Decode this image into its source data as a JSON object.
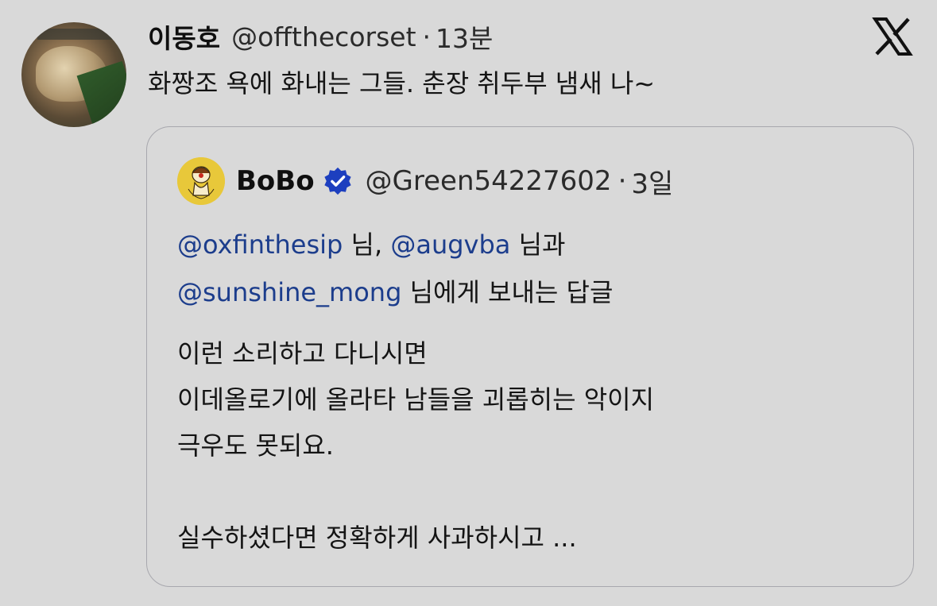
{
  "post": {
    "author_name": "이동호",
    "author_handle": "@offthecorset",
    "separator": "·",
    "time": "13분",
    "text": "화짱조 욕에 화내는 그들. 춘장 취두부 냄새 나~",
    "brand_icon": "x-logo-icon"
  },
  "quote": {
    "author_name": "BoBo",
    "verified_icon": "verified-badge-icon",
    "verified_color": "#1d3fbf",
    "author_handle": "@Green54227602",
    "separator": "·",
    "time": "3일",
    "reply_to": {
      "mention_1": "@oxfinthesip",
      "word_1": " 님, ",
      "mention_2": "@augvba",
      "word_2": " 님과",
      "mention_3": "@sunshine_mong",
      "word_3": " 님에게 보내는 답글"
    },
    "body_lines": [
      "이런 소리하고 다니시면",
      "이데올로기에 올라타 남들을 괴롭히는 악이지",
      "극우도 못되요.",
      "실수하셨다면 정확하게 사과하시고 ..."
    ]
  },
  "colors": {
    "background": "#d9d9d9",
    "mention": "#1c3d8c",
    "card_border": "#a8a8ae"
  }
}
